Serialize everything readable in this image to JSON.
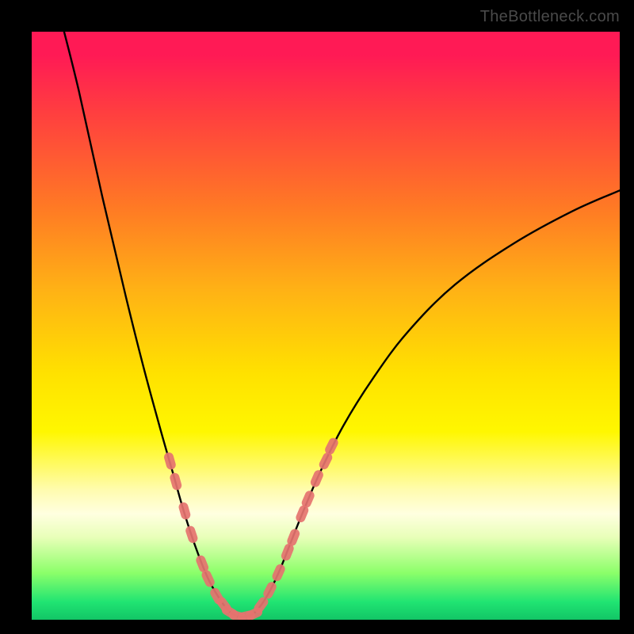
{
  "watermark": "TheBottleneck.com",
  "colors": {
    "frame": "#000000",
    "gradient_stops": [
      "#ff1a55",
      "#ff3f3f",
      "#ff7a24",
      "#ffb215",
      "#ffe100",
      "#fff700",
      "#fffcb0",
      "#ffffe0",
      "#e8ffb8",
      "#8cff6a",
      "#20e472",
      "#12c566"
    ],
    "curve": "#000000",
    "marker_fill": "#e5736f",
    "marker_stroke": "#e5736f"
  },
  "chart_data": {
    "type": "line",
    "title": "",
    "xlabel": "",
    "ylabel": "",
    "xlim": [
      0,
      100
    ],
    "ylim": [
      0,
      100
    ],
    "grid": false,
    "curve": [
      {
        "x": 5.0,
        "y": 102.0
      },
      {
        "x": 8.0,
        "y": 90.0
      },
      {
        "x": 12.0,
        "y": 72.0
      },
      {
        "x": 16.0,
        "y": 55.0
      },
      {
        "x": 19.0,
        "y": 43.0
      },
      {
        "x": 22.0,
        "y": 32.0
      },
      {
        "x": 24.0,
        "y": 25.0
      },
      {
        "x": 26.0,
        "y": 18.0
      },
      {
        "x": 28.0,
        "y": 12.0
      },
      {
        "x": 30.0,
        "y": 7.0
      },
      {
        "x": 32.0,
        "y": 3.5
      },
      {
        "x": 33.5,
        "y": 1.5
      },
      {
        "x": 35.0,
        "y": 0.6
      },
      {
        "x": 36.5,
        "y": 0.6
      },
      {
        "x": 38.0,
        "y": 1.3
      },
      {
        "x": 40.0,
        "y": 4.0
      },
      {
        "x": 42.0,
        "y": 8.0
      },
      {
        "x": 44.0,
        "y": 13.0
      },
      {
        "x": 46.0,
        "y": 18.0
      },
      {
        "x": 49.0,
        "y": 25.0
      },
      {
        "x": 53.0,
        "y": 33.0
      },
      {
        "x": 58.0,
        "y": 41.0
      },
      {
        "x": 64.0,
        "y": 49.0
      },
      {
        "x": 72.0,
        "y": 57.0
      },
      {
        "x": 82.0,
        "y": 64.0
      },
      {
        "x": 92.0,
        "y": 69.5
      },
      {
        "x": 100.0,
        "y": 73.0
      }
    ],
    "markers": [
      {
        "x": 23.5,
        "y": 27.0
      },
      {
        "x": 24.5,
        "y": 23.5
      },
      {
        "x": 26.0,
        "y": 18.5
      },
      {
        "x": 27.2,
        "y": 14.5
      },
      {
        "x": 29.0,
        "y": 9.5
      },
      {
        "x": 30.0,
        "y": 7.0
      },
      {
        "x": 31.5,
        "y": 4.0
      },
      {
        "x": 32.7,
        "y": 2.5
      },
      {
        "x": 33.7,
        "y": 1.3
      },
      {
        "x": 35.0,
        "y": 0.6
      },
      {
        "x": 36.5,
        "y": 0.6
      },
      {
        "x": 37.8,
        "y": 1.0
      },
      {
        "x": 39.0,
        "y": 2.5
      },
      {
        "x": 40.5,
        "y": 5.0
      },
      {
        "x": 42.0,
        "y": 8.0
      },
      {
        "x": 43.5,
        "y": 11.5
      },
      {
        "x": 44.5,
        "y": 14.0
      },
      {
        "x": 46.0,
        "y": 18.0
      },
      {
        "x": 47.0,
        "y": 20.5
      },
      {
        "x": 48.5,
        "y": 24.0
      },
      {
        "x": 50.0,
        "y": 27.0
      },
      {
        "x": 51.0,
        "y": 29.5
      }
    ]
  }
}
